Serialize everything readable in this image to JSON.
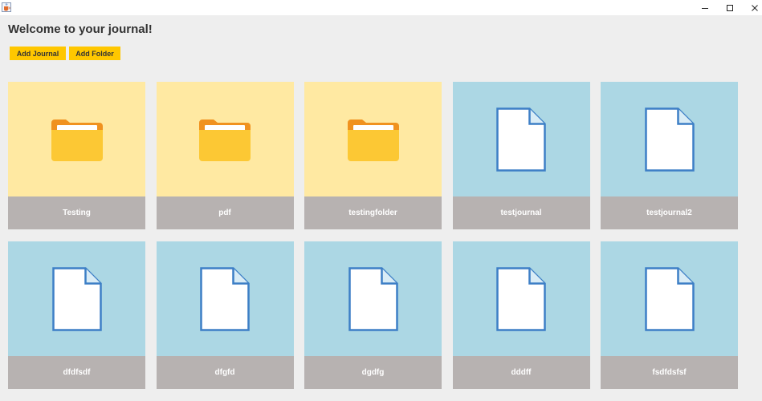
{
  "window": {
    "icons": {
      "app": "java-cup-icon",
      "minimize": "minimize-icon",
      "maximize": "maximize-icon",
      "close": "close-icon"
    }
  },
  "header": {
    "title": "Welcome to your journal!"
  },
  "toolbar": {
    "add_journal_label": "Add Journal",
    "add_folder_label": "Add Folder",
    "button_color": "#ffc700"
  },
  "colors": {
    "folder_tile": "#ffe9a2",
    "journal_tile": "#acd7e4",
    "label_bar": "#b7b2b1"
  },
  "items": [
    {
      "type": "folder",
      "name": "Testing"
    },
    {
      "type": "folder",
      "name": "pdf"
    },
    {
      "type": "folder",
      "name": "testingfolder"
    },
    {
      "type": "journal",
      "name": "testjournal"
    },
    {
      "type": "journal",
      "name": "testjournal2"
    },
    {
      "type": "journal",
      "name": "dfdfsdf"
    },
    {
      "type": "journal",
      "name": "dfgfd"
    },
    {
      "type": "journal",
      "name": "dgdfg"
    },
    {
      "type": "journal",
      "name": "dddff"
    },
    {
      "type": "journal",
      "name": "fsdfdsfsf"
    }
  ]
}
